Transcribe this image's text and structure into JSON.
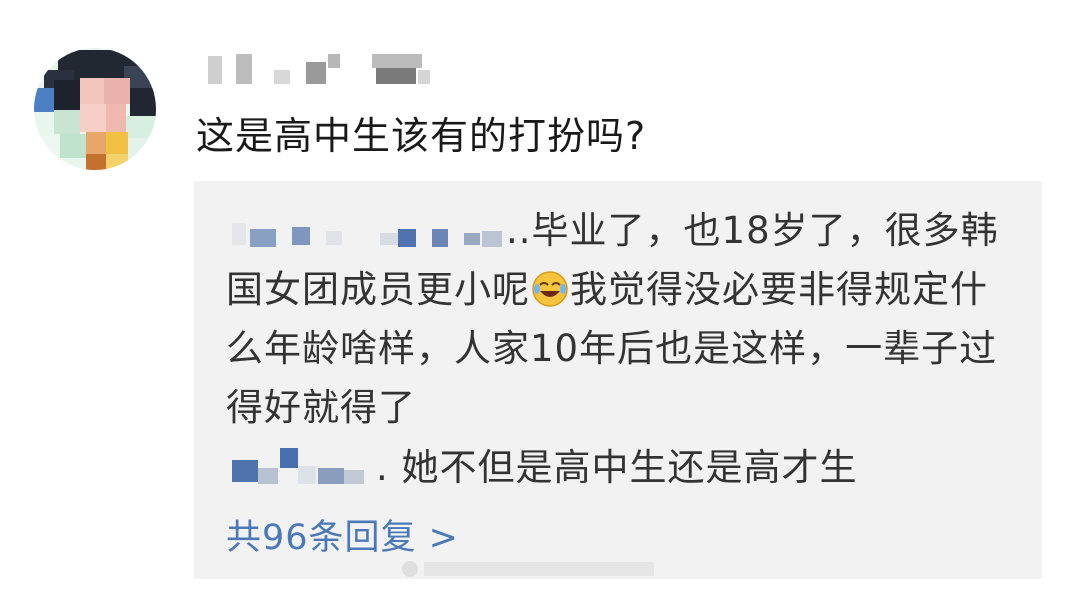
{
  "comment": {
    "text": "这是高中生该有的打扮吗?"
  },
  "replies": [
    {
      "text": "..毕业了，也18岁了，很多韩国女团成员更小呢😂我觉得没必要非得规定什么年龄啥样，人家10年后也是这样，一辈子过得好就得了"
    },
    {
      "text": ". 她不但是高中生还是高才生"
    }
  ],
  "more_replies": {
    "label": "共96条回复 >"
  },
  "colors": {
    "reply_box_bg": "#f2f2f2",
    "link": "#4a78b8",
    "text": "#1a1a1a"
  },
  "icons": {
    "emoji": "laughing-tears-emoji"
  }
}
